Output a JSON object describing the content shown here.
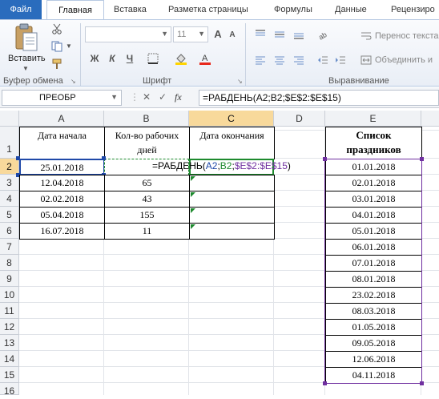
{
  "tabs": {
    "file": "Файл",
    "home": "Главная",
    "insert": "Вставка",
    "layout": "Разметка страницы",
    "formulas": "Формулы",
    "data": "Данные",
    "review": "Рецензиро"
  },
  "ribbon": {
    "paste_label": "Вставить",
    "clipboard_label": "Буфер обмена",
    "font_label": "Шрифт",
    "alignment_label": "Выравнивание",
    "font_size": "11",
    "bold": "Ж",
    "italic": "К",
    "underline": "Ч",
    "wrap_text": "Перенос текста",
    "merge_center": "Объединить и"
  },
  "formula_bar": {
    "name_box": "ПРЕОБР",
    "fx": "fx",
    "formula": "=РАБДЕНЬ(A2;B2;$E$2:$E$15)"
  },
  "columns": [
    "A",
    "B",
    "C",
    "D",
    "E"
  ],
  "rows": [
    "1",
    "2",
    "3",
    "4",
    "5",
    "6",
    "7",
    "8",
    "9",
    "10",
    "11",
    "12",
    "13",
    "14",
    "15",
    "16"
  ],
  "headers": {
    "a": "Дата начала",
    "b_line1": "Кол-во рабочих",
    "b_line2": "дней",
    "c": "Дата окончания",
    "e_line1": "Список",
    "e_line2": "праздников"
  },
  "table": [
    {
      "start": "25.01.2018",
      "days": "",
      "end": ""
    },
    {
      "start": "12.04.2018",
      "days": "65",
      "end": ""
    },
    {
      "start": "02.02.2018",
      "days": "43",
      "end": ""
    },
    {
      "start": "05.04.2018",
      "days": "155",
      "end": ""
    },
    {
      "start": "16.07.2018",
      "days": "11",
      "end": ""
    }
  ],
  "editing_formula": {
    "prefix": "=РАБДЕНЬ(",
    "ref_a": "A2",
    "sep1": ";",
    "ref_b": "B2",
    "sep2": ";",
    "ref_e": "$E$2:$E$15",
    "suffix": ")"
  },
  "holidays": [
    "01.01.2018",
    "02.01.2018",
    "03.01.2018",
    "04.01.2018",
    "05.01.2018",
    "06.01.2018",
    "07.01.2018",
    "08.01.2018",
    "23.02.2018",
    "08.03.2018",
    "01.05.2018",
    "09.05.2018",
    "12.06.2018",
    "04.11.2018"
  ],
  "colors": {
    "file_tab": "#2a6cbd",
    "ref_a": "#1f49a8",
    "ref_b": "#1e8a2e",
    "ref_e": "#7030a0",
    "selected_header": "#f8d99b"
  }
}
